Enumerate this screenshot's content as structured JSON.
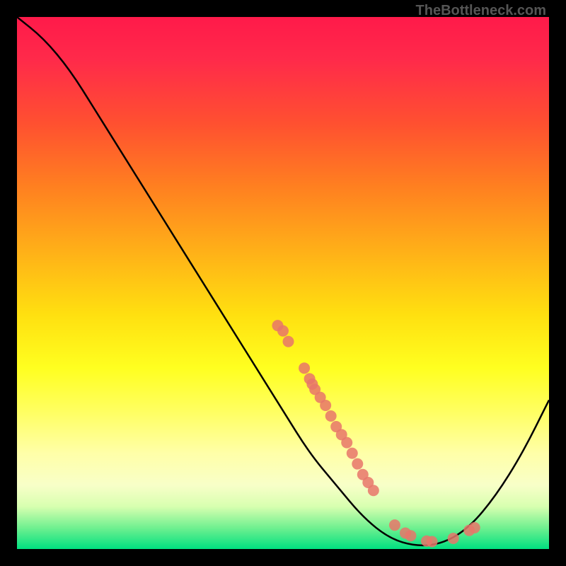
{
  "watermark": "TheBottleneck.com",
  "chart_data": {
    "type": "line",
    "title": "",
    "xlabel": "",
    "ylabel": "",
    "xlim": [
      0,
      100
    ],
    "ylim": [
      0,
      100
    ],
    "curve": [
      {
        "x": 0,
        "y": 100
      },
      {
        "x": 5,
        "y": 96
      },
      {
        "x": 10,
        "y": 90
      },
      {
        "x": 15,
        "y": 82
      },
      {
        "x": 20,
        "y": 74
      },
      {
        "x": 25,
        "y": 66
      },
      {
        "x": 30,
        "y": 58
      },
      {
        "x": 35,
        "y": 50
      },
      {
        "x": 40,
        "y": 42
      },
      {
        "x": 45,
        "y": 34
      },
      {
        "x": 50,
        "y": 26
      },
      {
        "x": 55,
        "y": 18
      },
      {
        "x": 60,
        "y": 12
      },
      {
        "x": 65,
        "y": 6
      },
      {
        "x": 70,
        "y": 2
      },
      {
        "x": 75,
        "y": 0.5
      },
      {
        "x": 80,
        "y": 1
      },
      {
        "x": 85,
        "y": 4
      },
      {
        "x": 90,
        "y": 10
      },
      {
        "x": 95,
        "y": 18
      },
      {
        "x": 100,
        "y": 28
      }
    ],
    "markers": [
      {
        "x": 49,
        "y": 42
      },
      {
        "x": 50,
        "y": 41
      },
      {
        "x": 51,
        "y": 39
      },
      {
        "x": 54,
        "y": 34
      },
      {
        "x": 55,
        "y": 32
      },
      {
        "x": 55.5,
        "y": 31
      },
      {
        "x": 56,
        "y": 30
      },
      {
        "x": 57,
        "y": 28.5
      },
      {
        "x": 58,
        "y": 27
      },
      {
        "x": 59,
        "y": 25
      },
      {
        "x": 60,
        "y": 23
      },
      {
        "x": 61,
        "y": 21.5
      },
      {
        "x": 62,
        "y": 20
      },
      {
        "x": 63,
        "y": 18
      },
      {
        "x": 64,
        "y": 16
      },
      {
        "x": 65,
        "y": 14
      },
      {
        "x": 66,
        "y": 12.5
      },
      {
        "x": 67,
        "y": 11
      },
      {
        "x": 71,
        "y": 4.5
      },
      {
        "x": 73,
        "y": 3
      },
      {
        "x": 74,
        "y": 2.5
      },
      {
        "x": 77,
        "y": 1.5
      },
      {
        "x": 78,
        "y": 1.4
      },
      {
        "x": 82,
        "y": 2
      },
      {
        "x": 85,
        "y": 3.5
      },
      {
        "x": 86,
        "y": 4
      }
    ],
    "marker_color": "#e8766a",
    "line_color": "#000000"
  }
}
